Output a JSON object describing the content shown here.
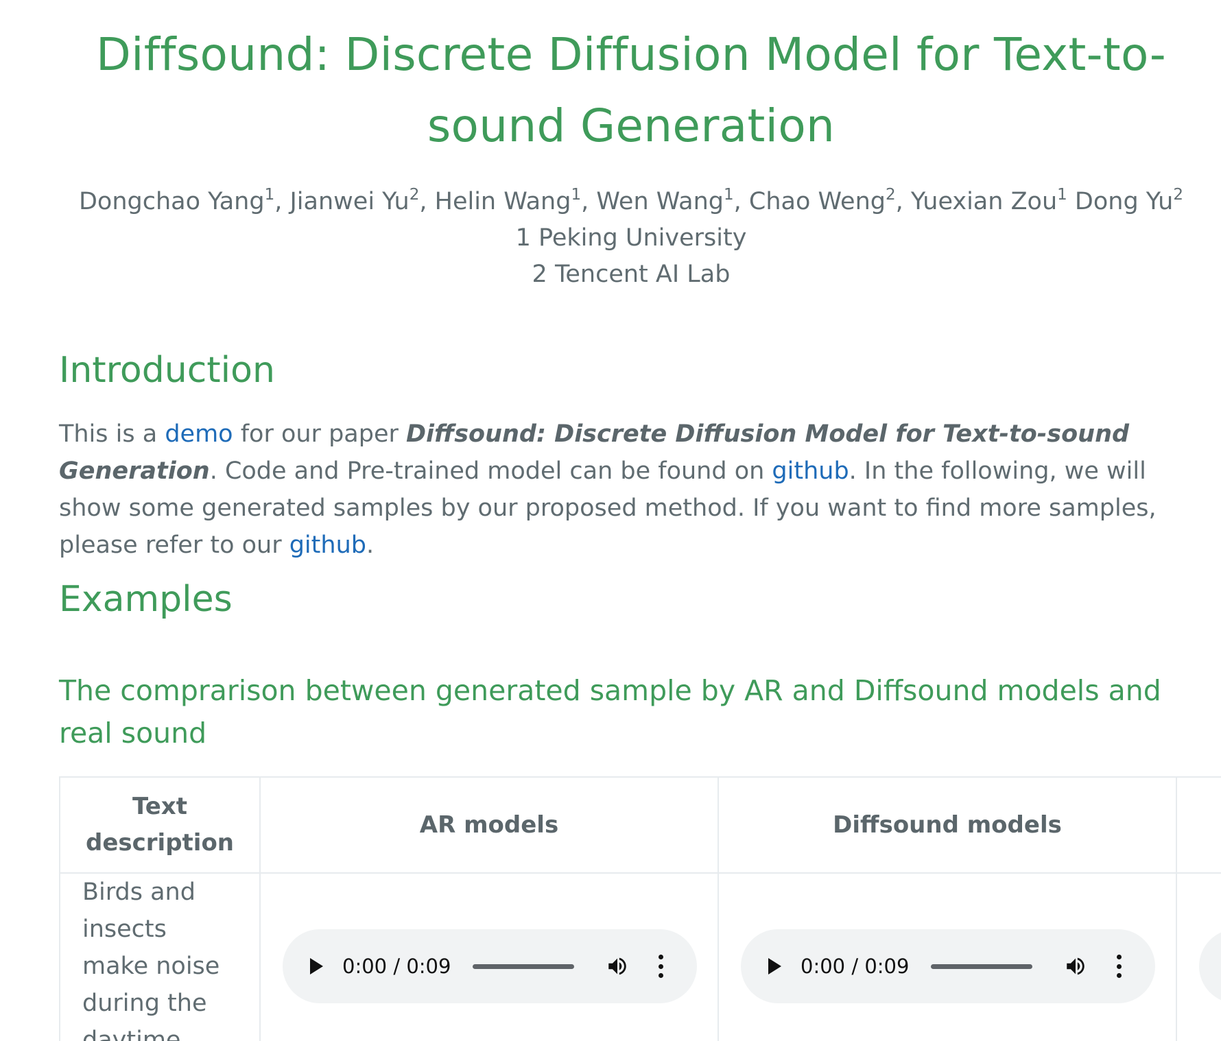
{
  "header": {
    "title": "Diffsound: Discrete Diffusion Model for Text-to-sound Generation",
    "authors": [
      {
        "name": "Dongchao Yang",
        "sup": "1",
        "sep": ", "
      },
      {
        "name": "Jianwei Yu",
        "sup": "2",
        "sep": ", "
      },
      {
        "name": "Helin Wang",
        "sup": "1",
        "sep": ", "
      },
      {
        "name": "Wen Wang",
        "sup": "1",
        "sep": ", "
      },
      {
        "name": "Chao Weng",
        "sup": "2",
        "sep": ", "
      },
      {
        "name": "Yuexian Zou",
        "sup": "1",
        "sep": " "
      },
      {
        "name": "Dong Yu",
        "sup": "2",
        "sep": ""
      }
    ],
    "affiliations": [
      "1 Peking University",
      "2 Tencent AI Lab"
    ]
  },
  "introduction": {
    "heading": "Introduction",
    "text_1": "This is a ",
    "link_demo": "demo",
    "text_2": " for our paper ",
    "paper_title": "Diffsound: Discrete Diffusion Model for Text-to-sound Generation",
    "text_3": ". Code and Pre-trained model can be found on ",
    "link_github_1": "github",
    "text_4": ". In the following, we will show some generated samples by our proposed method. If you want to find more samples, please refer to our ",
    "link_github_2": "github",
    "text_5": "."
  },
  "examples": {
    "heading": "Examples",
    "subheading": "The comprarison between generated sample by AR and Diffsound models and real sound",
    "table": {
      "headers": [
        "Text description",
        "AR models",
        "Diffsound models"
      ],
      "rows": [
        {
          "description": "Birds and insects make noise during the daytime",
          "ar_audio": {
            "time": "0:00 / 0:09"
          },
          "diffsound_audio": {
            "time": "0:00 / 0:09"
          }
        }
      ]
    }
  },
  "icons": {
    "play": "play-icon",
    "volume": "volume-icon",
    "more": "more-vert-icon"
  },
  "colors": {
    "heading_green": "#3f9b5a",
    "link_blue": "#1e6bb8",
    "body_text": "#606c71",
    "player_bg": "#f1f3f4"
  }
}
